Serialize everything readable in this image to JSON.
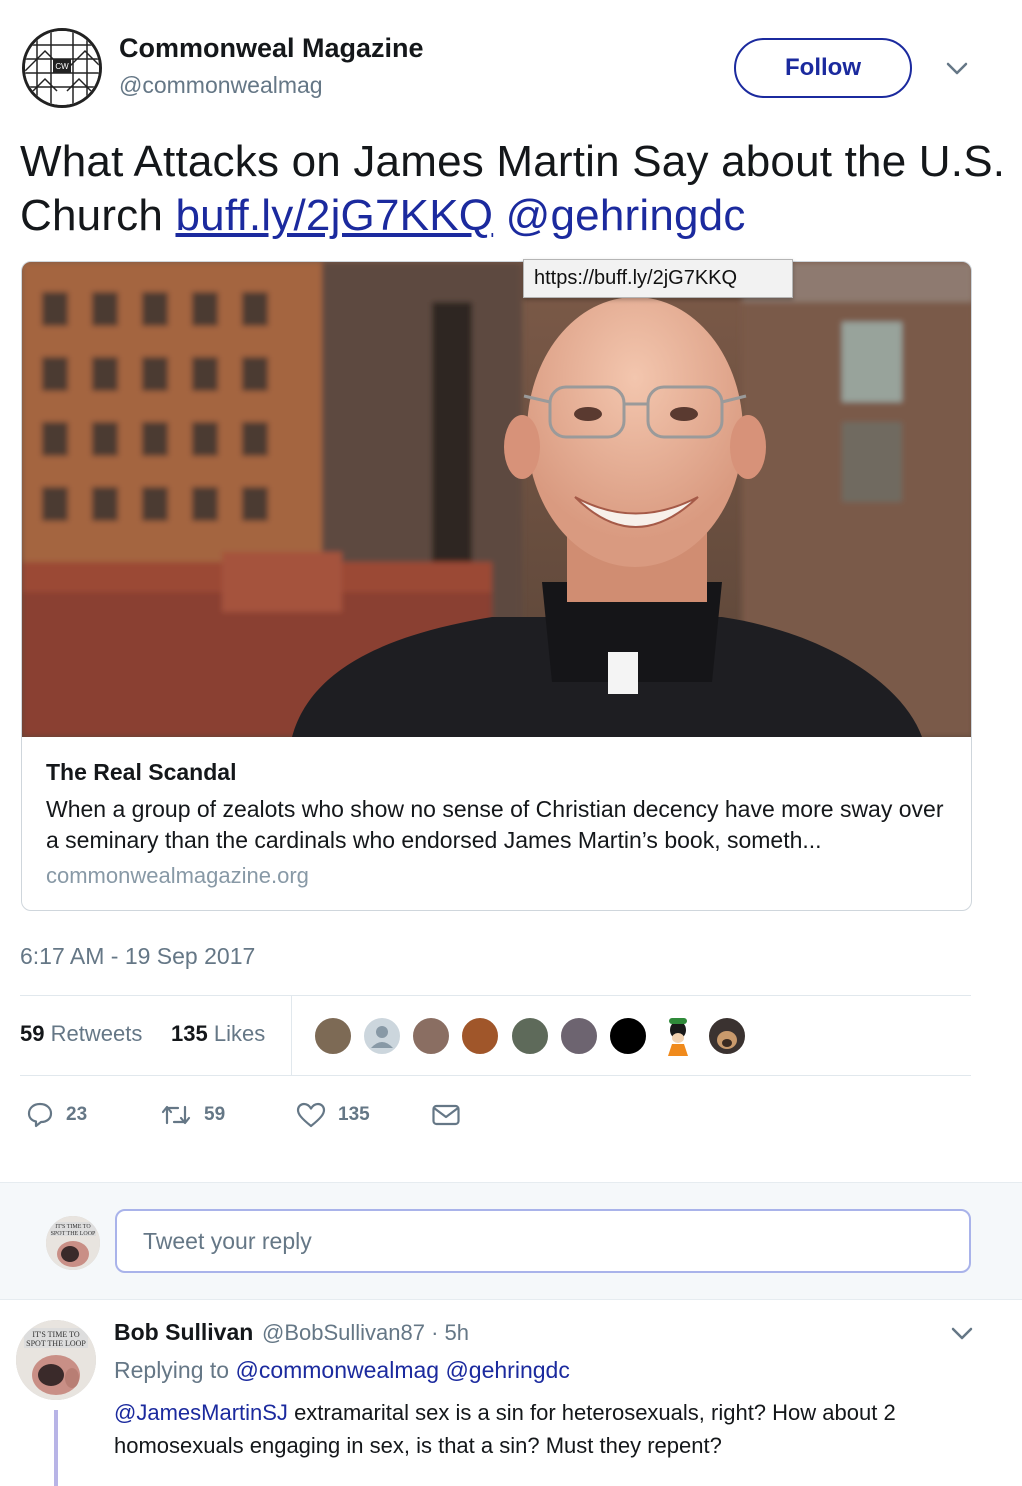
{
  "author": {
    "name": "Commonweal Magazine",
    "handle": "@commonwealmag",
    "follow_label": "Follow"
  },
  "tweet": {
    "text": "What Attacks on James Martin Say about the U.S. Church",
    "link": "buff.ly/2jG7KKQ",
    "mention": "@gehringdc",
    "timestamp": "6:17 AM - 19 Sep 2017"
  },
  "card": {
    "tooltip": "https://buff.ly/2jG7KKQ",
    "title": "The Real Scandal",
    "description": "When a group of zealots who show no sense of Christian decency have more sway over a seminary than the cardinals who endorsed James Martin’s book, someth...",
    "domain": "commonwealmagazine.org"
  },
  "stats": {
    "retweets_count": "59",
    "retweets_label": "Retweets",
    "likes_count": "135",
    "likes_label": "Likes"
  },
  "actions": {
    "replies": "23",
    "retweets": "59",
    "likes": "135"
  },
  "compose": {
    "placeholder": "Tweet your reply"
  },
  "reply": {
    "name": "Bob Sullivan",
    "meta": "@BobSullivan87 · 5h",
    "replying_prefix": "Replying to",
    "replying_to_1": "@commonwealmag",
    "replying_to_2": "@gehringdc",
    "mention": "@JamesMartinSJ",
    "text": "extramarital sex is a sin for heterosexuals, right? How about 2 homosexuals engaging in sex, is that a sin? Must they repent?"
  },
  "colors": {
    "link": "#1b2a9e",
    "secondary_text": "#657786",
    "border": "#e1e8ed"
  }
}
